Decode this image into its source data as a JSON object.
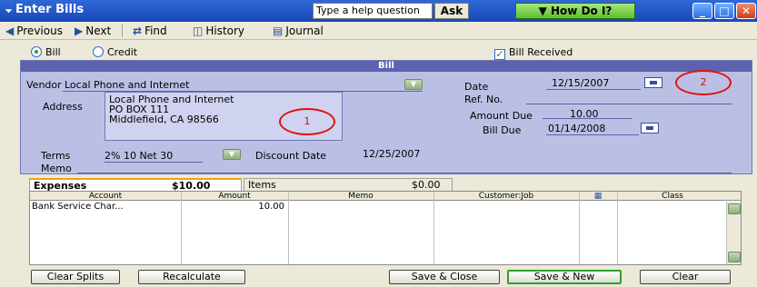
{
  "window": {
    "title": "Enter Bills",
    "help_placeholder": "Type a help question",
    "ask_label": "Ask",
    "howdo_label": "How Do I?"
  },
  "toolbar": {
    "previous": "Previous",
    "next": "Next",
    "find": "Find",
    "history": "History",
    "journal": "Journal"
  },
  "options": {
    "bill_label": "Bill",
    "credit_label": "Credit",
    "bill_received_label": "Bill Received",
    "bill_selected": true,
    "bill_received_checked": true
  },
  "form": {
    "header": "Bill",
    "vendor_label": "Vendor",
    "vendor_value": "Local Phone and Internet",
    "address_label": "Address",
    "address_lines": [
      "Local Phone and Internet",
      "PO BOX 111",
      "Middlefield, CA 98566"
    ],
    "date_label": "Date",
    "date_value": "12/15/2007",
    "ref_label": "Ref. No.",
    "ref_value": "",
    "amount_due_label": "Amount Due",
    "amount_due_value": "10.00",
    "bill_due_label": "Bill Due",
    "bill_due_value": "01/14/2008",
    "terms_label": "Terms",
    "terms_value": "2% 10 Net 30",
    "discount_date_label": "Discount Date",
    "discount_date_value": "12/25/2007",
    "memo_label": "Memo",
    "annotation_1": "1",
    "annotation_2": "2"
  },
  "tabs": {
    "expenses_label": "Expenses",
    "expenses_amount": "$10.00",
    "items_label": "Items",
    "items_amount": "$0.00"
  },
  "grid": {
    "columns": [
      "Account",
      "Amount",
      "Memo",
      "Customer:Job",
      "",
      "Class"
    ],
    "rows": [
      {
        "account": "Bank Service Char...",
        "amount": "10.00",
        "memo": "",
        "customer_job": "",
        "class": ""
      }
    ]
  },
  "buttons": {
    "clear_splits": "Clear Splits",
    "recalculate": "Recalculate",
    "save_close": "Save & Close",
    "save_new": "Save & New",
    "clear": "Clear"
  },
  "colors": {
    "form_bg": "#bcbfe4",
    "form_header": "#5c62ad",
    "titlebar": "#1848b8",
    "annotation_red": "#e01010"
  }
}
